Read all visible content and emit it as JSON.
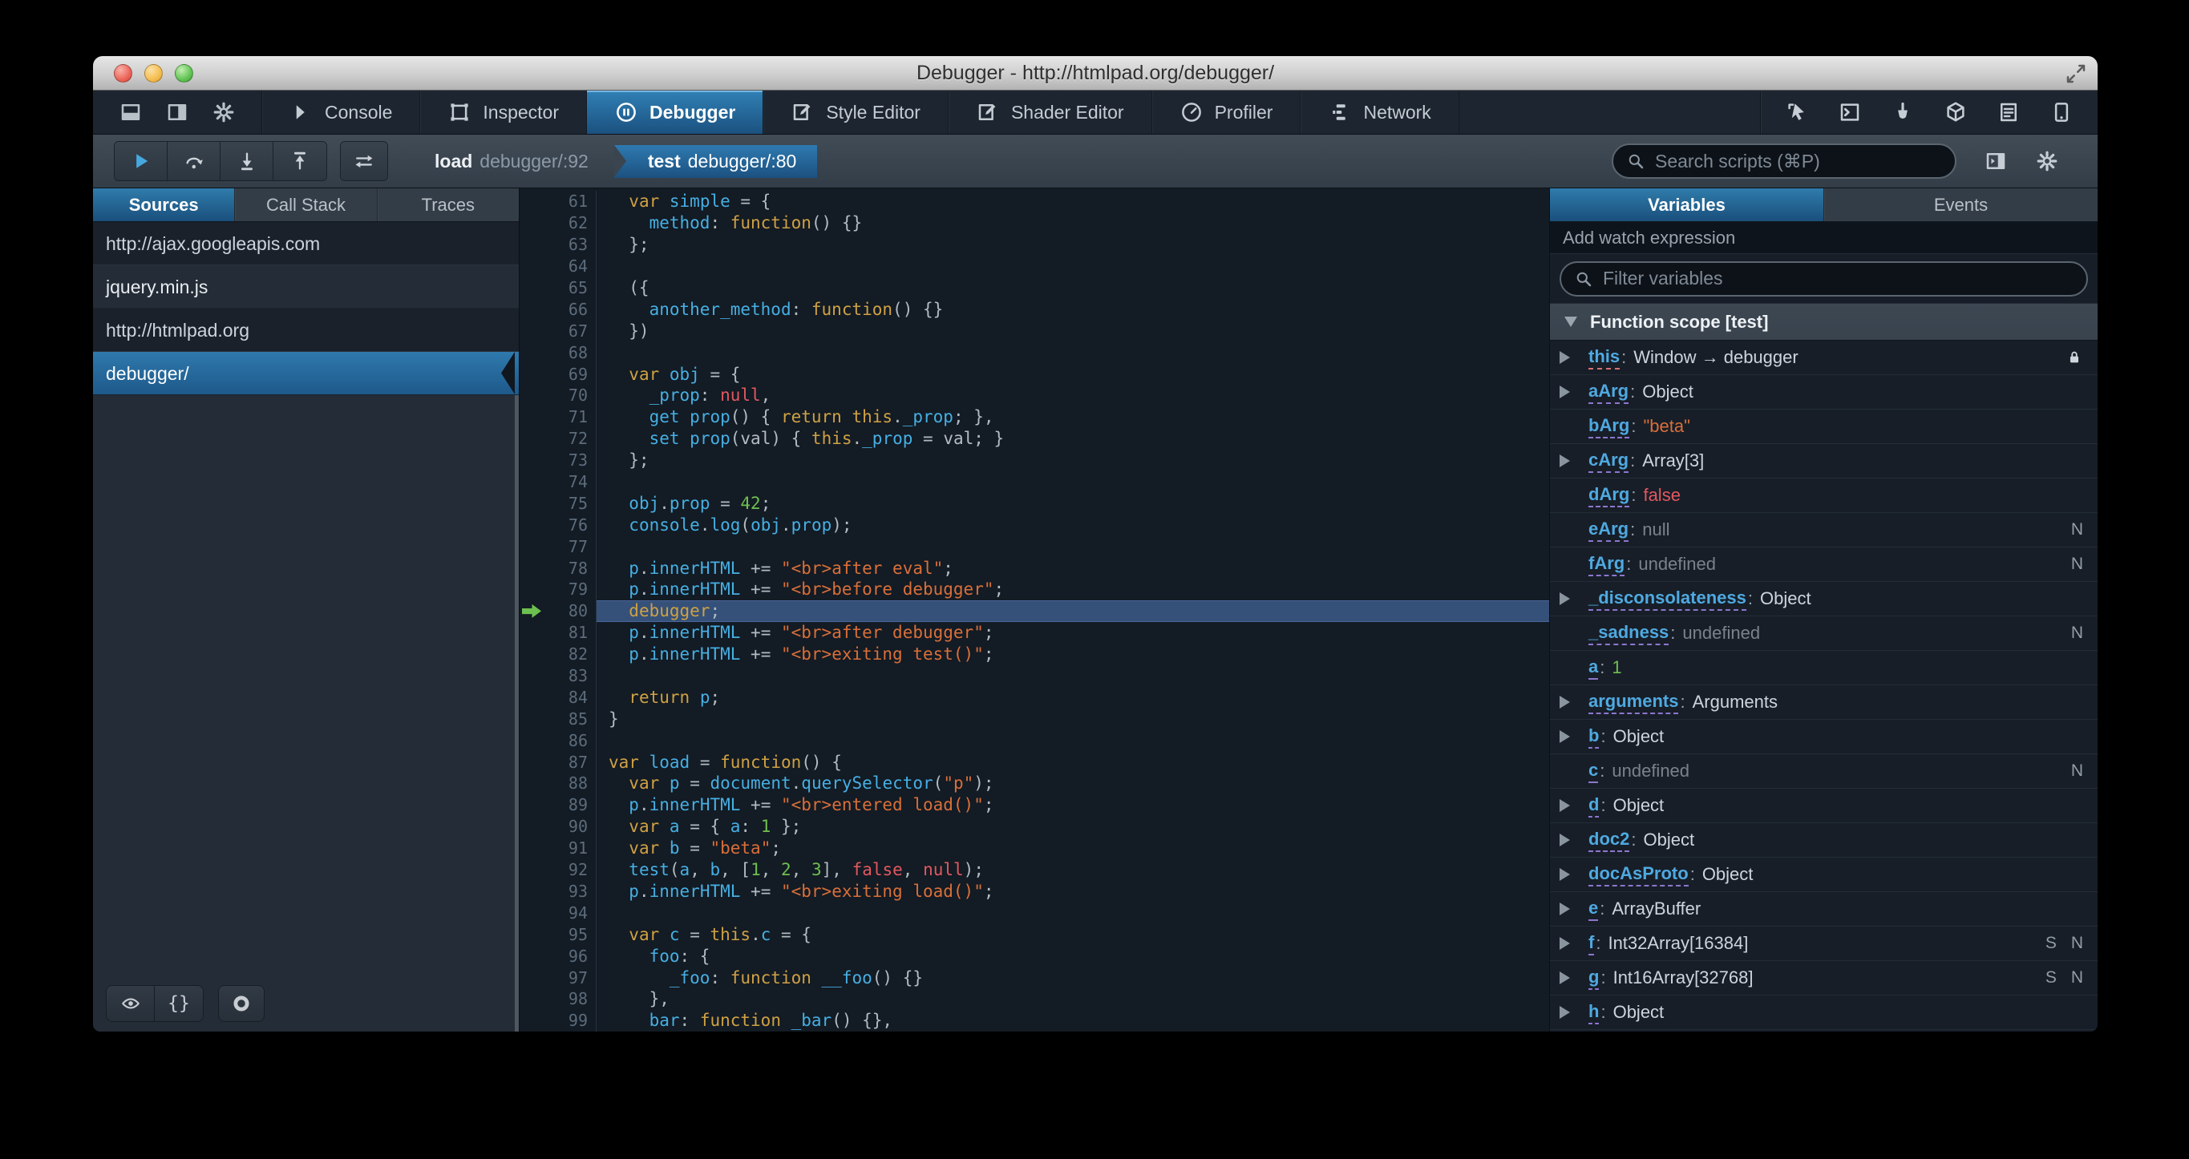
{
  "window": {
    "title": "Debugger - http://htmlpad.org/debugger/"
  },
  "toolbox": {
    "dock_icons": [
      "dock-bottom",
      "dock-side",
      "gear"
    ],
    "tabs": [
      {
        "label": "Console",
        "icon": "console",
        "active": false
      },
      {
        "label": "Inspector",
        "icon": "inspector",
        "active": false
      },
      {
        "label": "Debugger",
        "icon": "debugger",
        "active": true
      },
      {
        "label": "Style Editor",
        "icon": "style-editor",
        "active": false
      },
      {
        "label": "Shader Editor",
        "icon": "shader-editor",
        "active": false
      },
      {
        "label": "Profiler",
        "icon": "profiler",
        "active": false
      },
      {
        "label": "Network",
        "icon": "network",
        "active": false
      }
    ],
    "right_icons": [
      "pick-element",
      "split-console",
      "paintbrush",
      "tilt-3d",
      "scratchpad",
      "responsive-mode"
    ]
  },
  "debugger_toolbar": {
    "step_buttons": [
      "resume",
      "step-over",
      "step-in",
      "step-out"
    ],
    "blackbox_button": "blackbox",
    "stack_frames": [
      {
        "fn": "load",
        "location": "debugger/:92",
        "active": false
      },
      {
        "fn": "test",
        "location": "debugger/:80",
        "active": true
      }
    ],
    "search_placeholder": "Search scripts (⌘P)",
    "right_icons": [
      "panel-toggle",
      "gear"
    ]
  },
  "sources_panel": {
    "tabs": [
      "Sources",
      "Call Stack",
      "Traces"
    ],
    "active_tab": "Sources",
    "items": [
      {
        "label": "http://ajax.googleapis.com",
        "type": "group",
        "selected": false
      },
      {
        "label": "jquery.min.js",
        "type": "item",
        "selected": false
      },
      {
        "label": "http://htmlpad.org",
        "type": "group",
        "selected": false
      },
      {
        "label": "debugger/",
        "type": "item",
        "selected": true
      }
    ],
    "bottom_buttons": [
      "blackbox-eye",
      "pretty-print",
      "toggle-breakpoints"
    ]
  },
  "editor": {
    "current_line": 80,
    "lines": [
      {
        "n": 61,
        "t": [
          [
            "p",
            "  "
          ],
          [
            "k",
            "var"
          ],
          [
            "p",
            " "
          ],
          [
            "v",
            "simple"
          ],
          [
            "p",
            " = {"
          ]
        ]
      },
      {
        "n": 62,
        "t": [
          [
            "p",
            "    "
          ],
          [
            "v",
            "method"
          ],
          [
            "p",
            ": "
          ],
          [
            "k",
            "function"
          ],
          [
            "p",
            "() {}"
          ]
        ]
      },
      {
        "n": 63,
        "t": [
          [
            "p",
            "  };"
          ]
        ]
      },
      {
        "n": 64,
        "t": []
      },
      {
        "n": 65,
        "t": [
          [
            "p",
            "  ({"
          ]
        ]
      },
      {
        "n": 66,
        "t": [
          [
            "p",
            "    "
          ],
          [
            "v",
            "another_method"
          ],
          [
            "p",
            ": "
          ],
          [
            "k",
            "function"
          ],
          [
            "p",
            "() {}"
          ]
        ]
      },
      {
        "n": 67,
        "t": [
          [
            "p",
            "  })"
          ]
        ]
      },
      {
        "n": 68,
        "t": []
      },
      {
        "n": 69,
        "t": [
          [
            "p",
            "  "
          ],
          [
            "k",
            "var"
          ],
          [
            "p",
            " "
          ],
          [
            "v",
            "obj"
          ],
          [
            "p",
            " = {"
          ]
        ]
      },
      {
        "n": 70,
        "t": [
          [
            "p",
            "    "
          ],
          [
            "v",
            "_prop"
          ],
          [
            "p",
            ": "
          ],
          [
            "a",
            "null"
          ],
          [
            "p",
            ","
          ]
        ]
      },
      {
        "n": 71,
        "t": [
          [
            "p",
            "    "
          ],
          [
            "v",
            "get"
          ],
          [
            "p",
            " "
          ],
          [
            "v",
            "prop"
          ],
          [
            "p",
            "() { "
          ],
          [
            "k",
            "return"
          ],
          [
            "p",
            " "
          ],
          [
            "k",
            "this"
          ],
          [
            "p",
            "."
          ],
          [
            "v",
            "_prop"
          ],
          [
            "p",
            "; },"
          ]
        ]
      },
      {
        "n": 72,
        "t": [
          [
            "p",
            "    "
          ],
          [
            "v",
            "set"
          ],
          [
            "p",
            " "
          ],
          [
            "v",
            "prop"
          ],
          [
            "p",
            "("
          ],
          [
            "d",
            "val"
          ],
          [
            "p",
            ") { "
          ],
          [
            "k",
            "this"
          ],
          [
            "p",
            "."
          ],
          [
            "v",
            "_prop"
          ],
          [
            "p",
            " = "
          ],
          [
            "d",
            "val"
          ],
          [
            "p",
            "; }"
          ]
        ]
      },
      {
        "n": 73,
        "t": [
          [
            "p",
            "  };"
          ]
        ]
      },
      {
        "n": 74,
        "t": []
      },
      {
        "n": 75,
        "t": [
          [
            "p",
            "  "
          ],
          [
            "v",
            "obj"
          ],
          [
            "p",
            "."
          ],
          [
            "v",
            "prop"
          ],
          [
            "p",
            " = "
          ],
          [
            "n",
            "42"
          ],
          [
            "p",
            ";"
          ]
        ]
      },
      {
        "n": 76,
        "t": [
          [
            "p",
            "  "
          ],
          [
            "v",
            "console"
          ],
          [
            "p",
            "."
          ],
          [
            "v",
            "log"
          ],
          [
            "p",
            "("
          ],
          [
            "v",
            "obj"
          ],
          [
            "p",
            "."
          ],
          [
            "v",
            "prop"
          ],
          [
            "p",
            ");"
          ]
        ]
      },
      {
        "n": 77,
        "t": []
      },
      {
        "n": 78,
        "t": [
          [
            "p",
            "  "
          ],
          [
            "v",
            "p"
          ],
          [
            "p",
            "."
          ],
          [
            "v",
            "innerHTML"
          ],
          [
            "p",
            " += "
          ],
          [
            "s",
            "\"<br>after eval\""
          ],
          [
            "p",
            ";"
          ]
        ]
      },
      {
        "n": 79,
        "t": [
          [
            "p",
            "  "
          ],
          [
            "v",
            "p"
          ],
          [
            "p",
            "."
          ],
          [
            "v",
            "innerHTML"
          ],
          [
            "p",
            " += "
          ],
          [
            "s",
            "\"<br>before debugger\""
          ],
          [
            "p",
            ";"
          ]
        ]
      },
      {
        "n": 80,
        "current": true,
        "t": [
          [
            "p",
            "  "
          ],
          [
            "k",
            "debugger"
          ],
          [
            "p",
            ";"
          ]
        ]
      },
      {
        "n": 81,
        "t": [
          [
            "p",
            "  "
          ],
          [
            "v",
            "p"
          ],
          [
            "p",
            "."
          ],
          [
            "v",
            "innerHTML"
          ],
          [
            "p",
            " += "
          ],
          [
            "s",
            "\"<br>after debugger\""
          ],
          [
            "p",
            ";"
          ]
        ]
      },
      {
        "n": 82,
        "t": [
          [
            "p",
            "  "
          ],
          [
            "v",
            "p"
          ],
          [
            "p",
            "."
          ],
          [
            "v",
            "innerHTML"
          ],
          [
            "p",
            " += "
          ],
          [
            "s",
            "\"<br>exiting test()\""
          ],
          [
            "p",
            ";"
          ]
        ]
      },
      {
        "n": 83,
        "t": []
      },
      {
        "n": 84,
        "t": [
          [
            "p",
            "  "
          ],
          [
            "k",
            "return"
          ],
          [
            "p",
            " "
          ],
          [
            "v",
            "p"
          ],
          [
            "p",
            ";"
          ]
        ]
      },
      {
        "n": 85,
        "t": [
          [
            "p",
            "}"
          ]
        ]
      },
      {
        "n": 86,
        "t": []
      },
      {
        "n": 87,
        "t": [
          [
            "k",
            "var"
          ],
          [
            "p",
            " "
          ],
          [
            "v",
            "load"
          ],
          [
            "p",
            " = "
          ],
          [
            "k",
            "function"
          ],
          [
            "p",
            "() {"
          ]
        ]
      },
      {
        "n": 88,
        "t": [
          [
            "p",
            "  "
          ],
          [
            "k",
            "var"
          ],
          [
            "p",
            " "
          ],
          [
            "v",
            "p"
          ],
          [
            "p",
            " = "
          ],
          [
            "v",
            "document"
          ],
          [
            "p",
            "."
          ],
          [
            "v",
            "querySelector"
          ],
          [
            "p",
            "("
          ],
          [
            "s",
            "\"p\""
          ],
          [
            "p",
            ");"
          ]
        ]
      },
      {
        "n": 89,
        "t": [
          [
            "p",
            "  "
          ],
          [
            "v",
            "p"
          ],
          [
            "p",
            "."
          ],
          [
            "v",
            "innerHTML"
          ],
          [
            "p",
            " += "
          ],
          [
            "s",
            "\"<br>entered load()\""
          ],
          [
            "p",
            ";"
          ]
        ]
      },
      {
        "n": 90,
        "t": [
          [
            "p",
            "  "
          ],
          [
            "k",
            "var"
          ],
          [
            "p",
            " "
          ],
          [
            "v",
            "a"
          ],
          [
            "p",
            " = { "
          ],
          [
            "v",
            "a"
          ],
          [
            "p",
            ": "
          ],
          [
            "n",
            "1"
          ],
          [
            "p",
            " };"
          ]
        ]
      },
      {
        "n": 91,
        "t": [
          [
            "p",
            "  "
          ],
          [
            "k",
            "var"
          ],
          [
            "p",
            " "
          ],
          [
            "v",
            "b"
          ],
          [
            "p",
            " = "
          ],
          [
            "s",
            "\"beta\""
          ],
          [
            "p",
            ";"
          ]
        ]
      },
      {
        "n": 92,
        "t": [
          [
            "p",
            "  "
          ],
          [
            "v",
            "test"
          ],
          [
            "p",
            "("
          ],
          [
            "v",
            "a"
          ],
          [
            "p",
            ", "
          ],
          [
            "v",
            "b"
          ],
          [
            "p",
            ", ["
          ],
          [
            "n",
            "1"
          ],
          [
            "p",
            ", "
          ],
          [
            "n",
            "2"
          ],
          [
            "p",
            ", "
          ],
          [
            "n",
            "3"
          ],
          [
            "p",
            "], "
          ],
          [
            "a",
            "false"
          ],
          [
            "p",
            ", "
          ],
          [
            "a",
            "null"
          ],
          [
            "p",
            ");"
          ]
        ]
      },
      {
        "n": 93,
        "t": [
          [
            "p",
            "  "
          ],
          [
            "v",
            "p"
          ],
          [
            "p",
            "."
          ],
          [
            "v",
            "innerHTML"
          ],
          [
            "p",
            " += "
          ],
          [
            "s",
            "\"<br>exiting load()\""
          ],
          [
            "p",
            ";"
          ]
        ]
      },
      {
        "n": 94,
        "t": []
      },
      {
        "n": 95,
        "t": [
          [
            "p",
            "  "
          ],
          [
            "k",
            "var"
          ],
          [
            "p",
            " "
          ],
          [
            "v",
            "c"
          ],
          [
            "p",
            " = "
          ],
          [
            "k",
            "this"
          ],
          [
            "p",
            "."
          ],
          [
            "v",
            "c"
          ],
          [
            "p",
            " = {"
          ]
        ]
      },
      {
        "n": 96,
        "t": [
          [
            "p",
            "    "
          ],
          [
            "v",
            "foo"
          ],
          [
            "p",
            ": {"
          ]
        ]
      },
      {
        "n": 97,
        "t": [
          [
            "p",
            "      "
          ],
          [
            "v",
            "_foo"
          ],
          [
            "p",
            ": "
          ],
          [
            "k",
            "function"
          ],
          [
            "p",
            " "
          ],
          [
            "v",
            "__foo"
          ],
          [
            "p",
            "() {}"
          ]
        ]
      },
      {
        "n": 98,
        "t": [
          [
            "p",
            "    },"
          ]
        ]
      },
      {
        "n": 99,
        "t": [
          [
            "p",
            "    "
          ],
          [
            "v",
            "bar"
          ],
          [
            "p",
            ": "
          ],
          [
            "k",
            "function"
          ],
          [
            "p",
            " "
          ],
          [
            "v",
            "_bar"
          ],
          [
            "p",
            "() {},"
          ]
        ]
      }
    ]
  },
  "variables_panel": {
    "tabs": [
      "Variables",
      "Events"
    ],
    "active_tab": "Variables",
    "watch_label": "Add watch expression",
    "filter_placeholder": "Filter variables",
    "scope_label": "Function scope [test]",
    "rows": [
      {
        "name": "this",
        "value": "Window → debugger",
        "expand": true,
        "lock": true,
        "underline": "pink",
        "badges": []
      },
      {
        "name": "aArg",
        "value": "Object",
        "expand": true,
        "badges": []
      },
      {
        "name": "bArg",
        "value": "\"beta\"",
        "vclass": "str",
        "badges": []
      },
      {
        "name": "cArg",
        "value": "Array[3]",
        "expand": true,
        "badges": []
      },
      {
        "name": "dArg",
        "value": "false",
        "vclass": "atom",
        "badges": []
      },
      {
        "name": "eArg",
        "value": "null",
        "vclass": "dim",
        "badges": [
          "N"
        ]
      },
      {
        "name": "fArg",
        "value": "undefined",
        "vclass": "dim",
        "badges": [
          "N"
        ]
      },
      {
        "name": "_disconsolateness",
        "value": "Object",
        "expand": true,
        "badges": []
      },
      {
        "name": "_sadness",
        "value": "undefined",
        "vclass": "dim",
        "badges": [
          "N"
        ]
      },
      {
        "name": "a",
        "value": "1",
        "vclass": "num",
        "badges": []
      },
      {
        "name": "arguments",
        "value": "Arguments",
        "expand": true,
        "badges": []
      },
      {
        "name": "b",
        "value": "Object",
        "expand": true,
        "badges": []
      },
      {
        "name": "c",
        "value": "undefined",
        "vclass": "dim",
        "badges": [
          "N"
        ]
      },
      {
        "name": "d",
        "value": "Object",
        "expand": true,
        "badges": []
      },
      {
        "name": "doc2",
        "value": "Object",
        "expand": true,
        "badges": []
      },
      {
        "name": "docAsProto",
        "value": "Object",
        "expand": true,
        "badges": []
      },
      {
        "name": "e",
        "value": "ArrayBuffer",
        "expand": true,
        "badges": []
      },
      {
        "name": "f",
        "value": "Int32Array[16384]",
        "expand": true,
        "badges": [
          "S",
          "N"
        ]
      },
      {
        "name": "g",
        "value": "Int16Array[32768]",
        "expand": true,
        "badges": [
          "S",
          "N"
        ]
      },
      {
        "name": "h",
        "value": "Object",
        "expand": true,
        "badges": []
      }
    ]
  },
  "colors": {
    "accent_blue": "#2e7ab0",
    "exec_line_highlight": "#35517a",
    "exec_arrow_green": "#6cc04f",
    "syntax_keyword": "#cfa144",
    "syntax_identifier": "#46afe3",
    "syntax_string": "#d96f39",
    "syntax_number": "#6fbf4f",
    "syntax_atom": "#e2585f",
    "variable_name_blue": "#4fa9e0"
  }
}
